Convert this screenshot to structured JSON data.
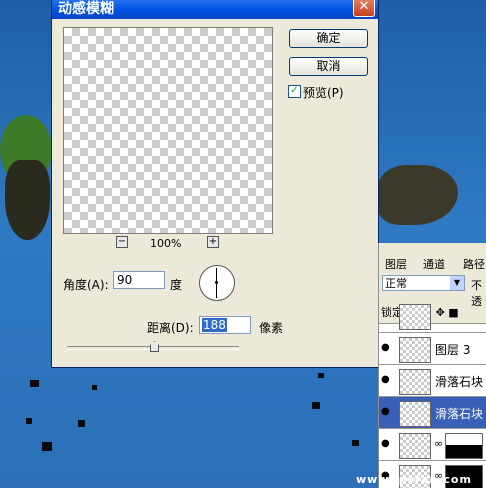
{
  "dialog": {
    "title": "动感模糊",
    "close_icon": "close-icon",
    "ok_label": "确定",
    "cancel_label": "取消",
    "preview_label": "预览(P)",
    "preview_checked": true,
    "zoom_out": "−",
    "zoom_in": "+",
    "zoom_level": "100%",
    "angle_label": "角度(A):",
    "angle_value": "90",
    "angle_unit": "度",
    "distance_label": "距离(D):",
    "distance_value": "188",
    "distance_unit": "像素"
  },
  "layers_panel": {
    "tabs": [
      "图层",
      "通道",
      "路径"
    ],
    "blend_mode": "正常",
    "opacity_label": "不透",
    "lock_label": "锁定:",
    "layers": [
      {
        "name": "",
        "selected": false
      },
      {
        "name": "图层 3",
        "selected": false
      },
      {
        "name": "滑落石块",
        "selected": false
      },
      {
        "name": "滑落石块",
        "selected": true
      },
      {
        "name": "",
        "selected": false,
        "has_mask": true
      },
      {
        "name": "",
        "selected": false,
        "has_mask": true
      }
    ]
  },
  "watermark": "www.ipsfan.com"
}
